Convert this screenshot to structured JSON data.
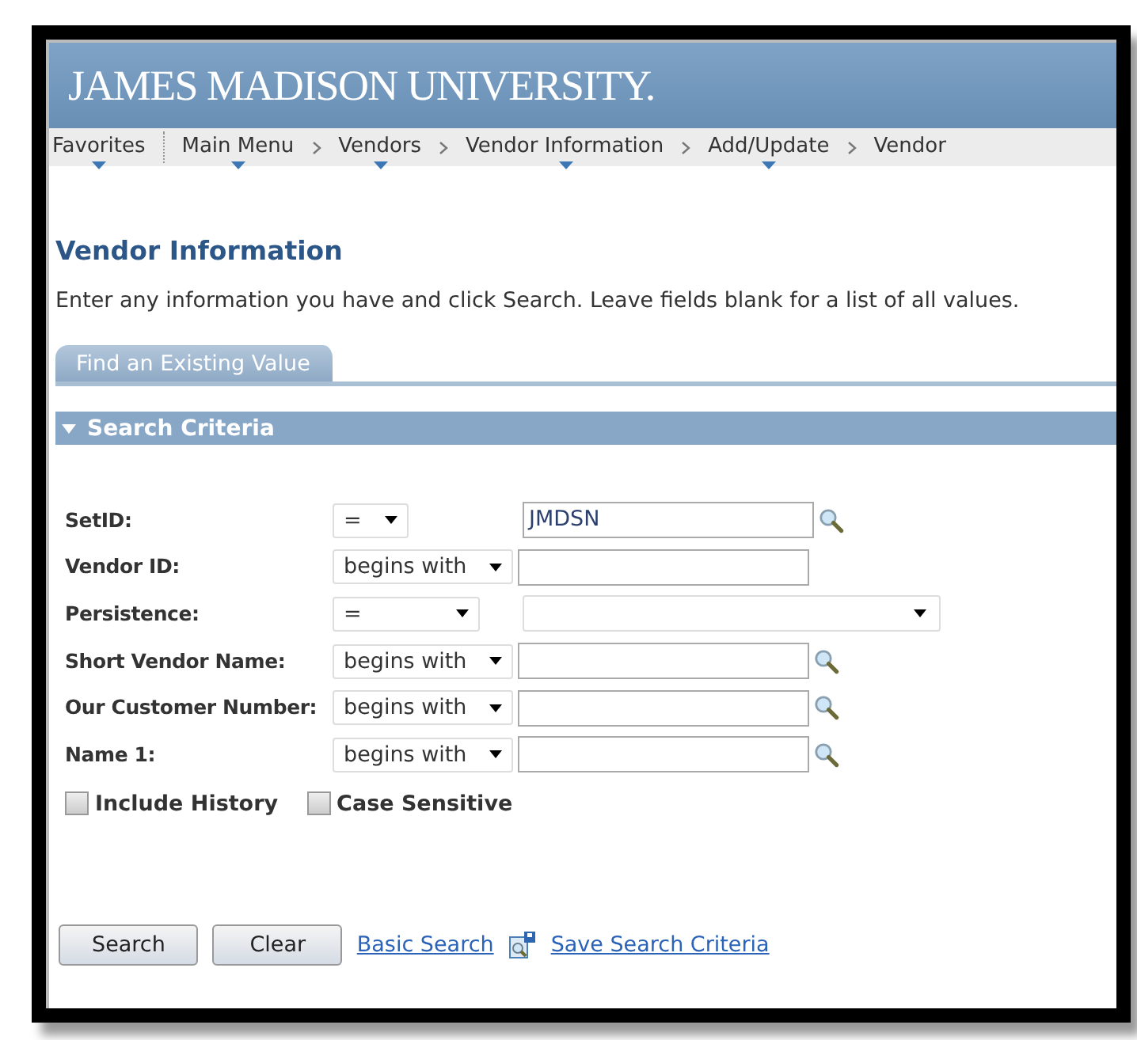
{
  "banner": {
    "title": "JAMES MADISON UNIVERSITY."
  },
  "breadcrumbs": [
    {
      "label": "Favorites",
      "menu": true
    },
    {
      "label": "Main Menu",
      "menu": true
    },
    {
      "label": "Vendors",
      "menu": true
    },
    {
      "label": "Vendor Information",
      "menu": true
    },
    {
      "label": "Add/Update",
      "menu": true
    },
    {
      "label": "Vendor",
      "menu": false
    }
  ],
  "page_title": "Vendor Information",
  "instructions": "Enter any information you have and click Search. Leave fields blank for a list of all values.",
  "tabs": [
    {
      "label": "Find an Existing Value",
      "selected": true
    }
  ],
  "section": {
    "title": "Search Criteria",
    "expanded": true
  },
  "fields": [
    {
      "label": "SetID:",
      "operator": "=",
      "kind": "text",
      "value": "JMDSN",
      "lookup": true
    },
    {
      "label": "Vendor ID:",
      "operator": "begins with",
      "kind": "text",
      "lookup": false
    },
    {
      "label": "Persistence:",
      "operator": "=",
      "kind": "dropdown",
      "lookup": false
    },
    {
      "label": "Short Vendor Name:",
      "operator": "begins with",
      "kind": "text",
      "lookup": true
    },
    {
      "label": "Our Customer Number:",
      "operator": "begins with",
      "kind": "text",
      "lookup": true
    },
    {
      "label": "Name 1:",
      "operator": "begins with",
      "kind": "text",
      "lookup": true
    }
  ],
  "options": [
    {
      "label": "Include History",
      "checked": false
    },
    {
      "label": "Case Sensitive",
      "checked": false
    }
  ],
  "buttons": [
    "Search",
    "Clear"
  ],
  "links": [
    {
      "label": "Basic Search",
      "icon": false
    },
    {
      "label": "Save Search Criteria",
      "icon": true
    }
  ]
}
